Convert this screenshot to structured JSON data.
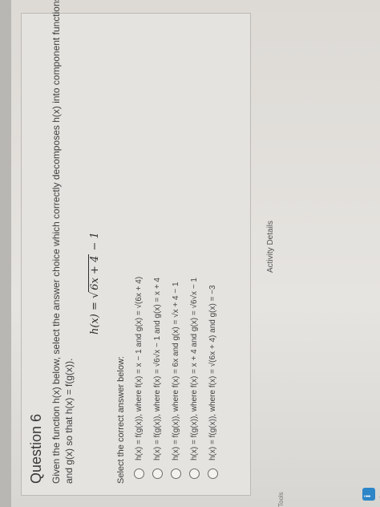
{
  "question": {
    "title": "Question 6",
    "prompt_line1": "Given the function h(x) below, select the answer choice which correctly decomposes h(x) into component functions f(x)",
    "prompt_line2": "and g(x) so that h(x) = f(g(x)).",
    "formula_lhs": "h(x) = ",
    "formula_radicand": "6x + 4",
    "formula_tail": " − 1",
    "instruction": "Select the correct answer below:"
  },
  "choices": [
    "h(x) = f(g(x)), where f(x) = x − 1 and g(x) = √(6x + 4)",
    "h(x) = f(g(x)), where f(x) = √6√x − 1 and g(x) = x + 4",
    "h(x) = f(g(x)), where f(x) = 6x and g(x) = √x + 4 − 1",
    "h(x) = f(g(x)), where f(x) = x + 4 and g(x) = √6√x − 1",
    "h(x) = f(g(x)), where f(x) = √(6x + 4) and g(x) = −3"
  ],
  "footer": {
    "activity_details": "Activity Details",
    "left_text": "Tools"
  },
  "colors": {
    "accent": "#2d86c8"
  }
}
